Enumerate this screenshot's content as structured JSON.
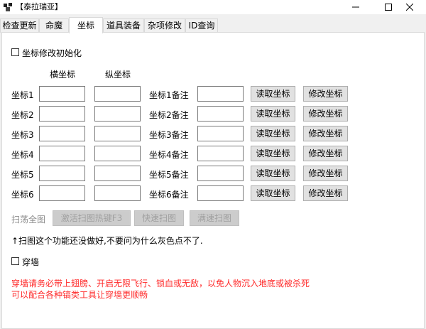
{
  "window": {
    "title": "【泰拉瑞亚】",
    "minimize_icon": "minimize-icon",
    "maximize_icon": "maximize-icon",
    "close_icon": "close-icon"
  },
  "tabs": [
    {
      "label": "检查更新"
    },
    {
      "label": "命魔"
    },
    {
      "label": "坐标"
    },
    {
      "label": "道具装备"
    },
    {
      "label": "杂项修改"
    },
    {
      "label": "ID查询"
    }
  ],
  "active_tab": "坐标",
  "coord_panel": {
    "init_checkbox_label": "坐标修改初始化",
    "header_x": "横坐标",
    "header_y": "纵坐标",
    "rows": [
      {
        "label": "坐标1",
        "x": "",
        "y": "",
        "note_label": "坐标1备注",
        "note": "",
        "read_label": "读取坐标",
        "modify_label": "修改坐标"
      },
      {
        "label": "坐标2",
        "x": "",
        "y": "",
        "note_label": "坐标2备注",
        "note": "",
        "read_label": "读取坐标",
        "modify_label": "修改坐标"
      },
      {
        "label": "坐标3",
        "x": "",
        "y": "",
        "note_label": "坐标3备注",
        "note": "",
        "read_label": "读取坐标",
        "modify_label": "修改坐标"
      },
      {
        "label": "坐标4",
        "x": "",
        "y": "",
        "note_label": "坐标4备注",
        "note": "",
        "read_label": "读取坐标",
        "modify_label": "修改坐标"
      },
      {
        "label": "坐标5",
        "x": "",
        "y": "",
        "note_label": "坐标5备注",
        "note": "",
        "read_label": "读取坐标",
        "modify_label": "修改坐标"
      },
      {
        "label": "坐标6",
        "x": "",
        "y": "",
        "note_label": "坐标6备注",
        "note": "",
        "read_label": "读取坐标",
        "modify_label": "修改坐标"
      }
    ],
    "scan_label": "扫荡全图",
    "scan_hotkey_button": "激活扫图热键F3",
    "quick_scan_button": "快速扫图",
    "full_scan_button": "满速扫图",
    "scan_note": "↑扫图这个功能还没做好,不要问为什么灰色点不了.",
    "wall_checkbox_label": "穿墙",
    "wall_warning_line1": "穿墙请务必带上翅膀、开启无限飞行、锁血或无敌，以免人物沉入地底或被杀死",
    "wall_warning_line2": "可以配合各种镐类工具让穿墙更顺畅"
  },
  "colors": {
    "warning": "#ff2a2a",
    "disabled_text": "#a0a0a0",
    "panel_bg": "#ffffff",
    "window_bg": "#f0f0f0"
  }
}
